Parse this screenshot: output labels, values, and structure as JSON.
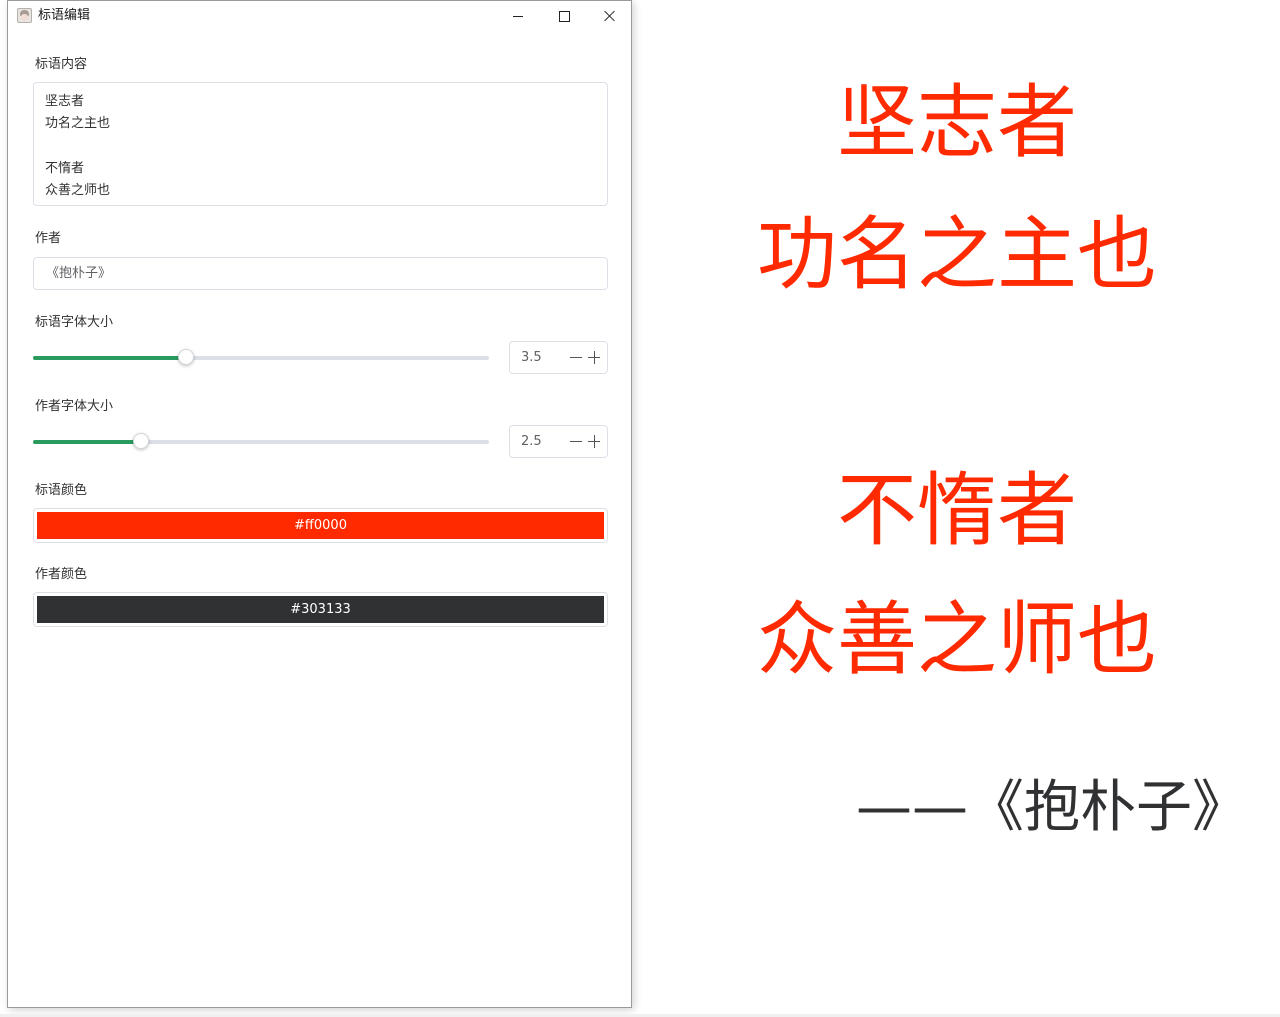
{
  "window": {
    "title": "标语编辑",
    "icon": "avatar-app-icon"
  },
  "form": {
    "slogan": {
      "label": "标语内容",
      "value": "坚志者\n功名之主也\n\n不惰者\n众善之师也"
    },
    "author": {
      "label": "作者",
      "value": "《抱朴子》"
    },
    "slogan_font_size": {
      "label": "标语字体大小",
      "value": "3.5",
      "slider_fraction": 0.336
    },
    "author_font_size": {
      "label": "作者字体大小",
      "value": "2.5",
      "slider_fraction": 0.237
    },
    "slogan_color": {
      "label": "标语颜色",
      "value": "#ff0000",
      "swatch": "#ff2a00"
    },
    "author_color": {
      "label": "作者颜色",
      "value": "#303133",
      "swatch": "#303133"
    }
  },
  "preview": {
    "lines": [
      "坚志者",
      "功名之主也",
      "",
      "不惰者",
      "众善之师也"
    ],
    "author_line": "——《抱朴子》",
    "slogan_color": "#ff2a00",
    "author_color": "#303133"
  },
  "colors": {
    "slider_fill": "#2a9b5e",
    "border": "#dcdfe6"
  }
}
